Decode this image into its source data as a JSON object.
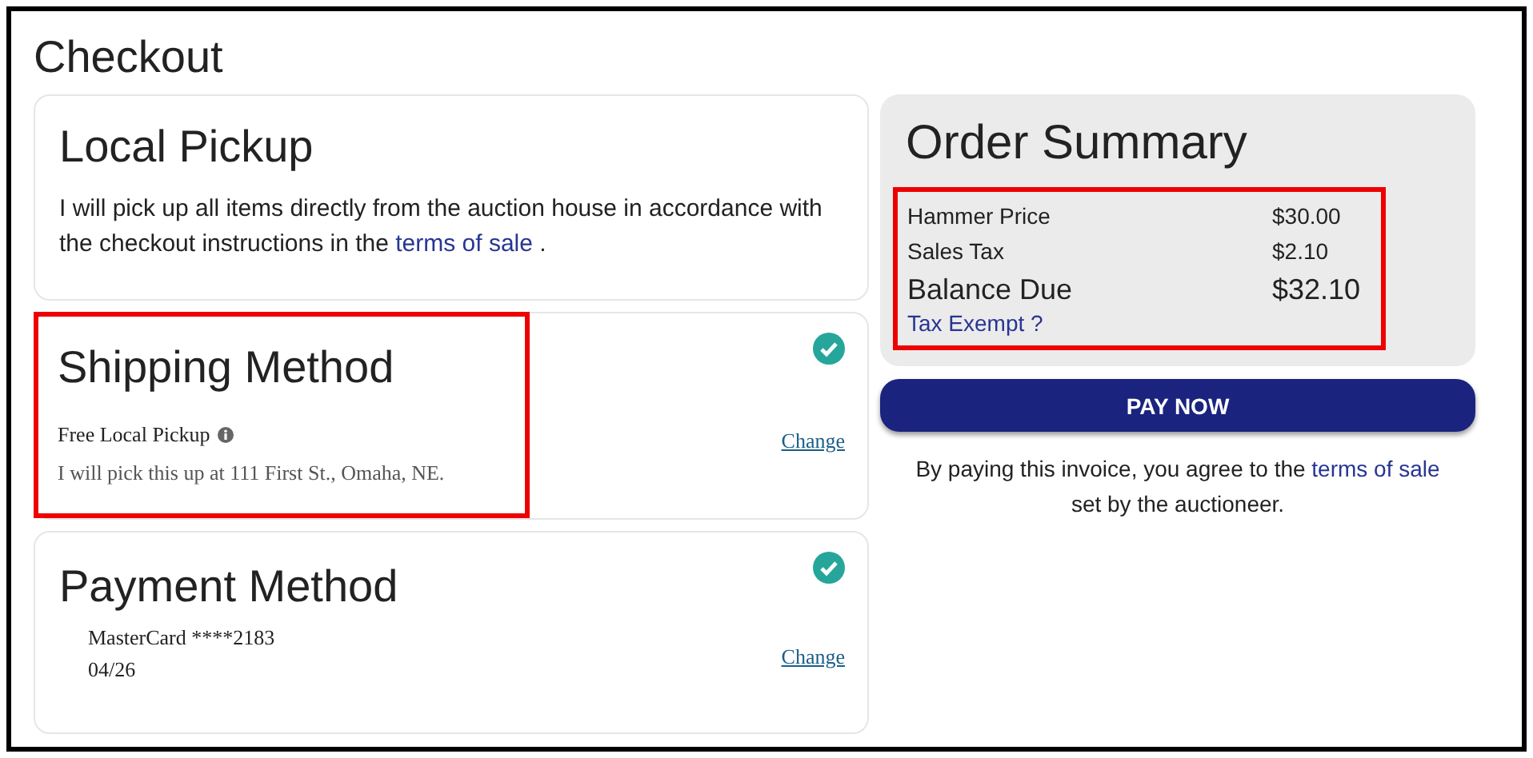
{
  "page_title": "Checkout",
  "local_pickup": {
    "title": "Local Pickup",
    "text_before": "I will pick up all items directly from the auction house in accordance with the checkout instructions in the",
    "link": "terms of sale",
    "text_after": "."
  },
  "shipping": {
    "title": "Shipping Method",
    "complete": true,
    "highlighted": true,
    "option": "Free Local Pickup",
    "note": "I will pick this up at 111 First St., Omaha, NE.",
    "change": "Change"
  },
  "payment": {
    "title": "Payment Method",
    "complete": true,
    "card": "MasterCard ****2183",
    "expiry": "04/26",
    "change": "Change"
  },
  "summary": {
    "title": "Order Summary",
    "highlighted": true,
    "lines": [
      {
        "label": "Hammer Price",
        "amount": "$30.00",
        "kind": "line"
      },
      {
        "label": "Sales Tax",
        "amount": "$2.10",
        "kind": "line"
      },
      {
        "label": "Balance Due",
        "amount": "$32.10",
        "kind": "total"
      }
    ],
    "tax_exempt": "Tax Exempt ?"
  },
  "pay_button": "PAY NOW",
  "agreement": {
    "text_before": "By paying this invoice, you agree to the",
    "link": "terms of sale",
    "text_after": "set by the auctioneer."
  }
}
